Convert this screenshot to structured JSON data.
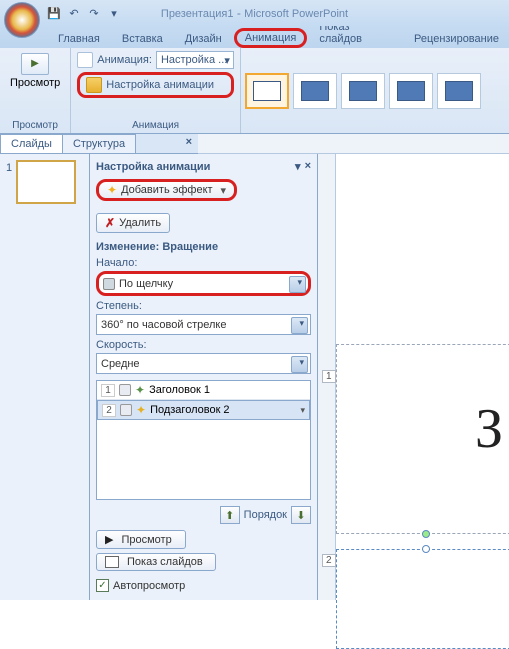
{
  "title": {
    "doc": "Презентация1",
    "app": "Microsoft PowerPoint"
  },
  "tabs": {
    "home": "Главная",
    "insert": "Вставка",
    "design": "Дизайн",
    "animation": "Анимация",
    "slideshow": "Показ слайдов",
    "review": "Рецензирование"
  },
  "ribbon": {
    "preview": "Просмотр",
    "preview_group": "Просмотр",
    "anim_label": "Анимация:",
    "anim_value": "Настройка ...",
    "custom_anim": "Настройка анимации",
    "anim_group": "Анимация"
  },
  "side_tabs": {
    "slides": "Слайды",
    "outline": "Структура"
  },
  "slide_panel": {
    "num1": "1"
  },
  "pane": {
    "title": "Настройка анимации",
    "add_effect": "Добавить эффект",
    "remove": "Удалить",
    "change_title": "Изменение: Вращение",
    "start_label": "Начало:",
    "start_value": "По щелчку",
    "degree_label": "Степень:",
    "degree_value": "360° по часовой стрелке",
    "speed_label": "Скорость:",
    "speed_value": "Средне",
    "effects": [
      {
        "num": "1",
        "name": "Заголовок 1"
      },
      {
        "num": "2",
        "name": "Подзаголовок 2"
      }
    ],
    "order": "Порядок",
    "play": "Просмотр",
    "slideshow": "Показ слайдов",
    "autopreview": "Автопросмотр"
  },
  "canvas": {
    "text": "З",
    "label1": "1",
    "label2": "2"
  }
}
